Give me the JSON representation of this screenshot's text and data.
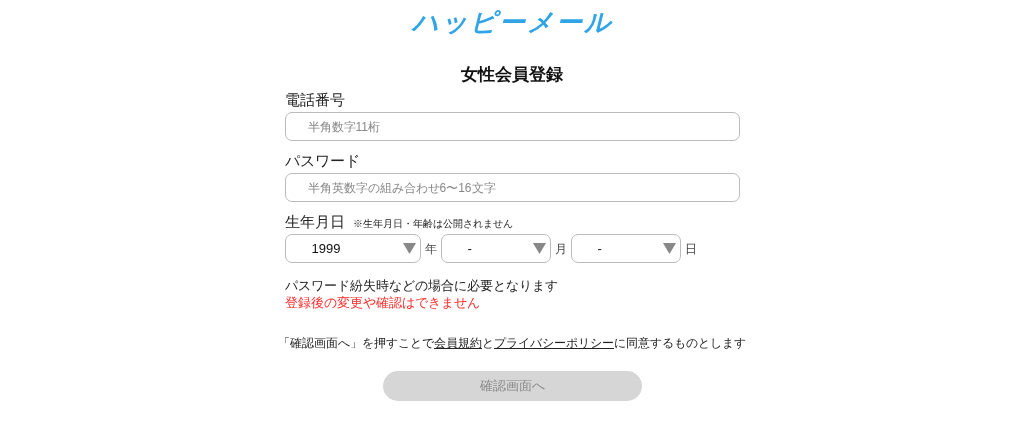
{
  "logo": "ハッピーメール",
  "title": "女性会員登録",
  "fields": [
    {
      "label": "電話番号",
      "placeholder": "半角数字11桁"
    },
    {
      "label": "パスワード",
      "placeholder": "半角英数字の組み合わせ6〜16文字"
    }
  ],
  "birthday": {
    "label": "生年月日",
    "note": "※生年月日・年齢は公開されません",
    "selects": [
      {
        "value": "1999",
        "unit": "年"
      },
      {
        "value": "-",
        "unit": "月"
      },
      {
        "value": "-",
        "unit": "日"
      }
    ]
  },
  "notice": "パスワード紛失時などの場合に必要となります",
  "warning": "登録後の変更や確認はできません",
  "consent": [
    {
      "kind": "text",
      "text": "「確認画面へ」を押すことで"
    },
    {
      "kind": "link",
      "text": "会員規約"
    },
    {
      "kind": "text",
      "text": "と"
    },
    {
      "kind": "link",
      "text": "プライバシーポリシー"
    },
    {
      "kind": "text",
      "text": "に同意するものとします"
    }
  ],
  "submit": {
    "label": "確認画面へ",
    "disabled": true
  }
}
